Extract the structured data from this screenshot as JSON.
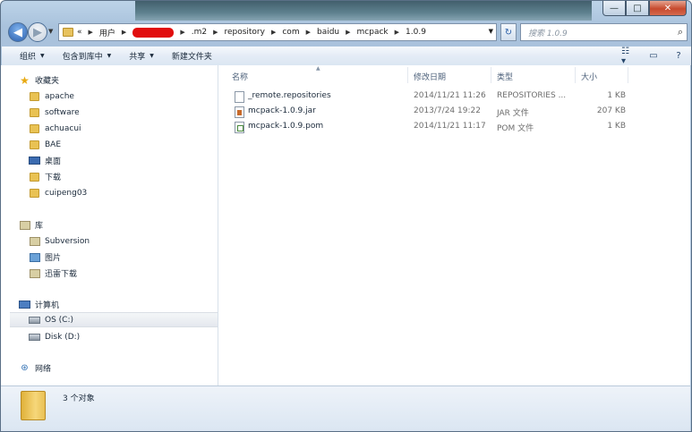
{
  "window": {
    "buttons": {
      "minimize": "—",
      "maximize": "□",
      "close": "✕"
    }
  },
  "nav": {
    "back_icon": "back-arrow-icon",
    "forward_icon": "forward-arrow-icon",
    "breadcrumb": [
      "«",
      "用户",
      "",
      ".m2",
      "repository",
      "com",
      "baidu",
      "mcpack",
      "1.0.9"
    ],
    "search_placeholder": "搜索 1.0.9"
  },
  "toolbar": {
    "organize": "组织",
    "include_library": "包含到库中",
    "share": "共享",
    "new_folder": "新建文件夹"
  },
  "sidebar": {
    "favorites_label": "收藏夹",
    "favorites": [
      "apache",
      "software",
      "achuacui",
      "BAE",
      "桌面",
      "下载",
      "cuipeng03"
    ],
    "libraries_label": "库",
    "libraries": [
      "Subversion",
      "图片",
      "迅雷下载"
    ],
    "computer_label": "计算机",
    "drives": [
      "OS (C:)",
      "Disk (D:)"
    ],
    "network_label": "网络"
  },
  "columns": {
    "name": "名称",
    "modified": "修改日期",
    "type": "类型",
    "size": "大小"
  },
  "files": [
    {
      "name": "_remote.repositories",
      "modified": "2014/11/21 11:26",
      "type": "REPOSITORIES ...",
      "size": "1 KB"
    },
    {
      "name": "mcpack-1.0.9.jar",
      "modified": "2013/7/24 19:22",
      "type": "JAR 文件",
      "size": "207 KB"
    },
    {
      "name": "mcpack-1.0.9.pom",
      "modified": "2014/11/21 11:17",
      "type": "POM 文件",
      "size": "1 KB"
    }
  ],
  "status": {
    "count": "3 个对象"
  }
}
